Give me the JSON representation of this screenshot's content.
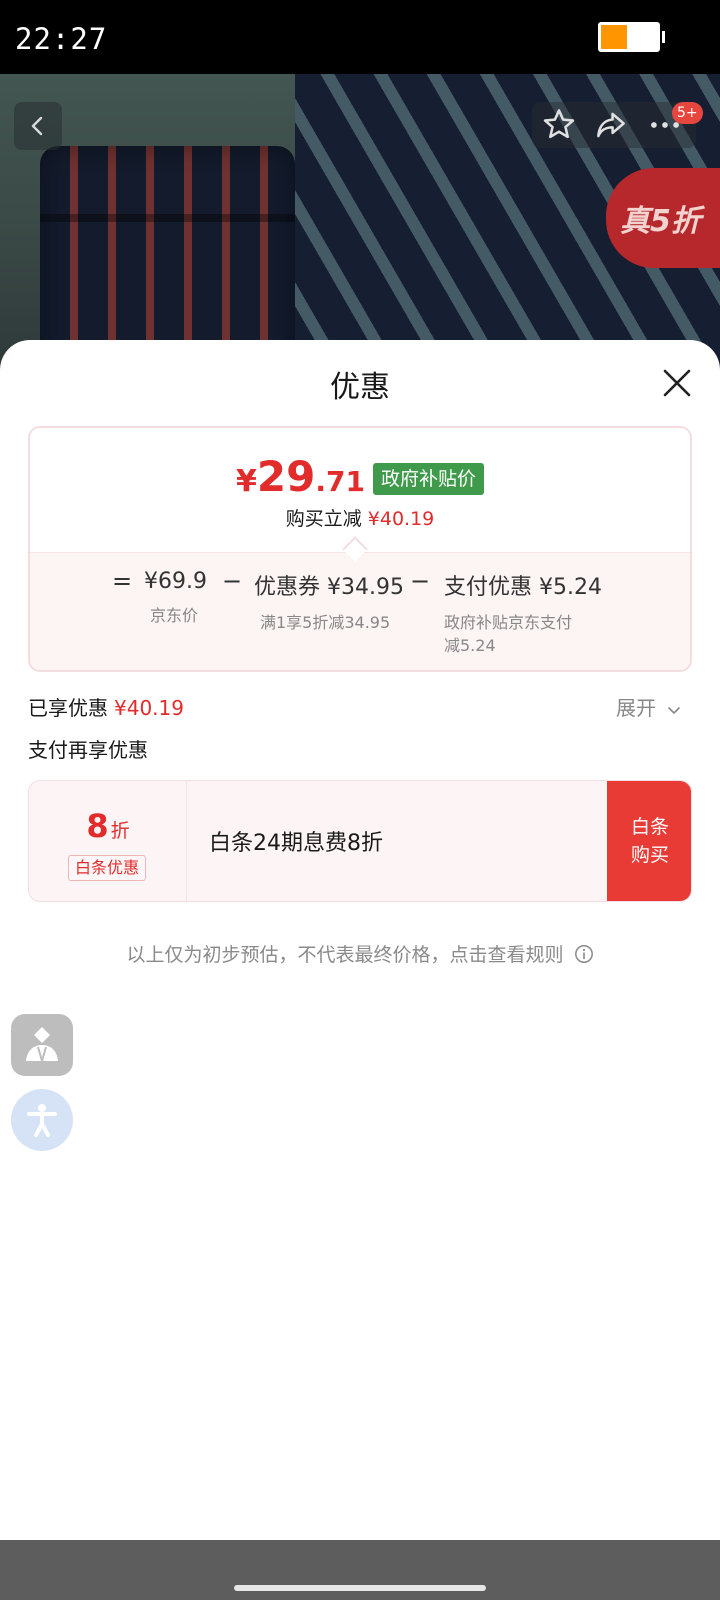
{
  "status_bar": {
    "time": "22:27"
  },
  "hero": {
    "promo_tag": "真5折",
    "more_badge": "5+",
    "icons": [
      "back-icon",
      "star-icon",
      "share-icon",
      "more-icon"
    ]
  },
  "sheet": {
    "title": "优惠",
    "close_icon": "close-icon",
    "price": {
      "currency": "¥",
      "integer": "29",
      "decimal": ".71",
      "tag": "政府补贴价",
      "save_label": "购买立减",
      "save_value": "¥40.19"
    },
    "breakdown": {
      "equals": "=",
      "minus": "−",
      "items": [
        {
          "value": "¥69.9",
          "label": "京东价"
        },
        {
          "value": "优惠券 ¥34.95",
          "label": "满1享5折减34.95"
        },
        {
          "value": "支付优惠 ¥5.24",
          "label_line1": "政府补贴京东支付",
          "label_line2": "减5.24"
        }
      ]
    },
    "enjoyed": {
      "label": "已享优惠",
      "value": "¥40.19"
    },
    "expand_label": "展开",
    "pay_section_title": "支付再享优惠",
    "baitiao": {
      "discount_num": "8",
      "discount_unit": "折",
      "tag": "白条优惠",
      "text": "白条24期息费8折",
      "buy_line1": "白条",
      "buy_line2": "购买"
    },
    "disclaimer": "以上仅为初步预估，不代表最终价格，点击查看规则"
  },
  "colors": {
    "accent_red": "#e22b2b",
    "tag_green": "#3f9a4c",
    "buy_red": "#e83b36",
    "battery_orange": "#ff9500"
  }
}
